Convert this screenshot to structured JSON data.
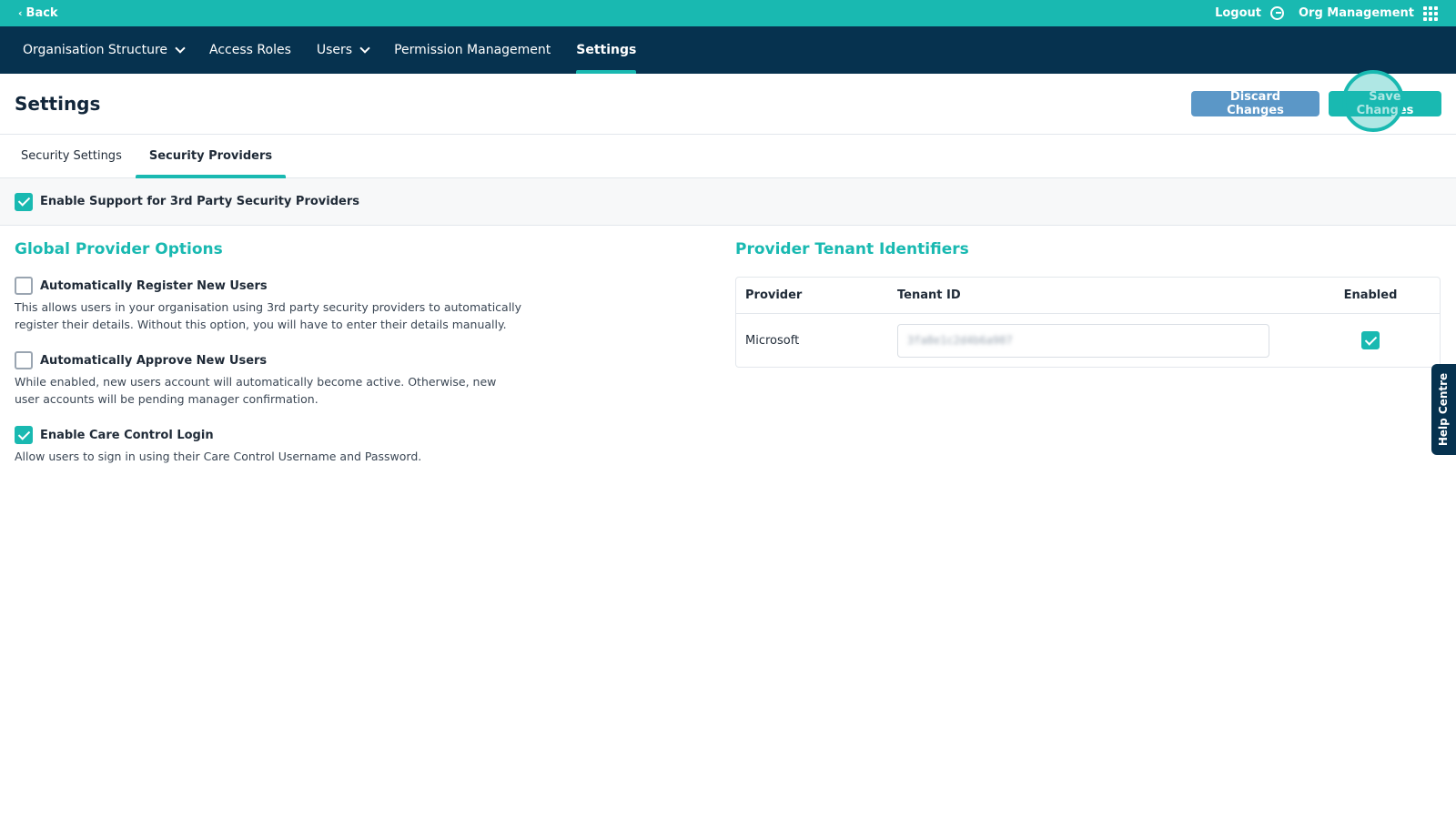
{
  "topbar": {
    "back_label": "Back",
    "logout_label": "Logout",
    "org_label": "Org Management"
  },
  "nav": {
    "items": [
      {
        "label": "Organisation Structure",
        "has_dropdown": true
      },
      {
        "label": "Access Roles",
        "has_dropdown": false
      },
      {
        "label": "Users",
        "has_dropdown": true
      },
      {
        "label": "Permission Management",
        "has_dropdown": false
      },
      {
        "label": "Settings",
        "has_dropdown": false,
        "active": true
      }
    ]
  },
  "header": {
    "title": "Settings",
    "discard_label": "Discard Changes",
    "save_label": "Save Changes"
  },
  "tabs": [
    {
      "label": "Security Settings",
      "active": false
    },
    {
      "label": "Security Providers",
      "active": true
    }
  ],
  "banner": {
    "label": "Enable Support for 3rd Party Security Providers",
    "checked": true
  },
  "global_options": {
    "title": "Global Provider Options",
    "options": [
      {
        "label": "Automatically Register New Users",
        "checked": false,
        "description": "This allows users in your organisation using 3rd party security providers to automatically register their details. Without this option, you will have to enter their details manually."
      },
      {
        "label": "Automatically Approve New Users",
        "checked": false,
        "description": "While enabled, new users account will automatically become active. Otherwise, new user accounts will be pending manager confirmation."
      },
      {
        "label": "Enable Care Control Login",
        "checked": true,
        "description": "Allow users to sign in using their Care Control Username and Password."
      }
    ]
  },
  "tenant_identifiers": {
    "title": "Provider Tenant Identifiers",
    "columns": {
      "provider": "Provider",
      "tenant": "Tenant ID",
      "enabled": "Enabled"
    },
    "rows": [
      {
        "provider": "Microsoft",
        "tenant_id": "3fa8e1c2d4b6a907",
        "enabled": true
      }
    ]
  },
  "help": {
    "label": "Help Centre"
  },
  "colors": {
    "accent": "#19b9b1",
    "navy": "#06324f",
    "discard": "#5b97c7"
  }
}
